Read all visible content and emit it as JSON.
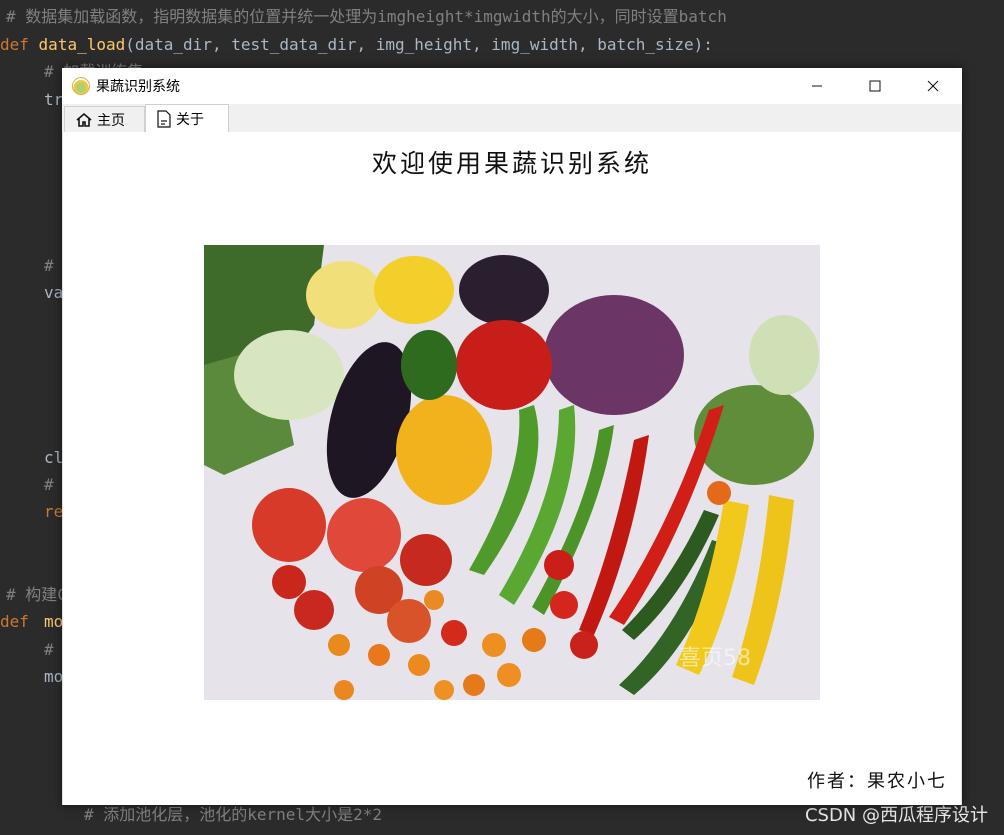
{
  "code": {
    "line1_comment": "# 数据集加载函数，指明数据集的位置并统一处理为imgheight*imgwidth的大小，同时设置batch",
    "line2_def": "def",
    "line2_fn": "data_load",
    "line2_args": "(data_dir, test_data_dir, img_height, img_width, batch_size):",
    "line3": "# 加载训练集",
    "frag_tr": "tr",
    "frag_hash": "#",
    "frag_va": "va",
    "frag_cl": "cl",
    "frag_hash2": "#",
    "frag_re": "re",
    "line_build": "# 构建C",
    "frag_def2": "def",
    "frag_mo": "mo",
    "frag_hash3": "#",
    "frag_mo2": "mo",
    "last_comment": "# 添加池化层，池化的kernel大小是2*2"
  },
  "watermark": "CSDN @西瓜程序设计",
  "window": {
    "title": "果蔬识别系统",
    "minimize": "—",
    "maximize": "☐",
    "close": "✕"
  },
  "tabs": [
    {
      "label": "主页",
      "icon": "home-icon"
    },
    {
      "label": "关于",
      "icon": "document-icon"
    }
  ],
  "main": {
    "heading": "欢迎使用果蔬识别系统",
    "image_alt": "蔬菜图片",
    "photo_watermark": "喜页58",
    "author": "作者：果农小七"
  }
}
